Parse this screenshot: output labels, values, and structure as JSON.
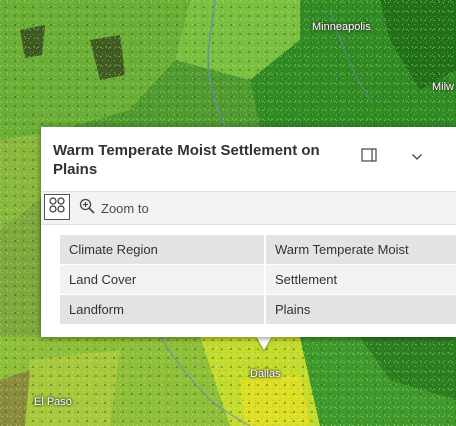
{
  "map": {
    "cities": {
      "minneapolis": "Minneapolis",
      "milwaukee": "Milw",
      "dallas": "Dallas",
      "el_paso": "El Paso"
    },
    "colors": {
      "base": "#4f9a2c",
      "light_green": "#86c840",
      "dark_green": "#2f7a1e",
      "yellow_green": "#b9d82e",
      "olive": "#8a8a3a"
    }
  },
  "popup": {
    "title": "Warm Temperate Moist Settlement on Plains",
    "dock_icon": "dock-side-icon",
    "collapse_icon": "chevron-down-icon",
    "features_icon": "features-list-icon",
    "zoom_icon": "zoom-in-magnifier-icon",
    "zoom_label": "Zoom to",
    "fields": [
      {
        "key": "Climate Region",
        "value": "Warm Temperate Moist"
      },
      {
        "key": "Land Cover",
        "value": "Settlement"
      },
      {
        "key": "Landform",
        "value": "Plains"
      }
    ]
  }
}
